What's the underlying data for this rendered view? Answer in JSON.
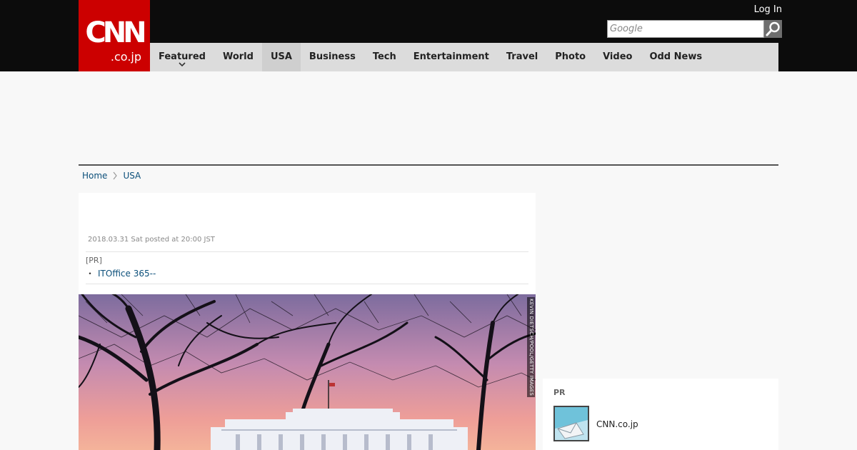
{
  "header": {
    "logo_main": "CNN",
    "logo_sub": ".co.jp",
    "login_label": "Log In",
    "search": {
      "placeholder": "Google",
      "value": ""
    }
  },
  "nav": {
    "items": [
      {
        "label": "Featured"
      },
      {
        "label": "World"
      },
      {
        "label": "USA"
      },
      {
        "label": "Business"
      },
      {
        "label": "Tech"
      },
      {
        "label": "Entertainment"
      },
      {
        "label": "Travel"
      },
      {
        "label": "Photo"
      },
      {
        "label": "Video"
      },
      {
        "label": "Odd News"
      }
    ],
    "active": "USA"
  },
  "breadcrumb": {
    "home": "Home",
    "current": "USA"
  },
  "article": {
    "posted": "2018.03.31 Sat posted at 20:00 JST",
    "pr_label": "[PR]",
    "pr_bullet": "・",
    "pr_link": "ITOffice 365--",
    "photo_credit": "KEVIN DIETSCH/POOL/GETTY IMAGES"
  },
  "sidebar": {
    "pr_title": "PR",
    "item_text": "CNN.co.jp"
  },
  "colors": {
    "brand_red": "#cc0000",
    "header_black": "#0c0c0c",
    "nav_gray": "#dcdcdc",
    "link_blue": "#0b4f7a"
  }
}
